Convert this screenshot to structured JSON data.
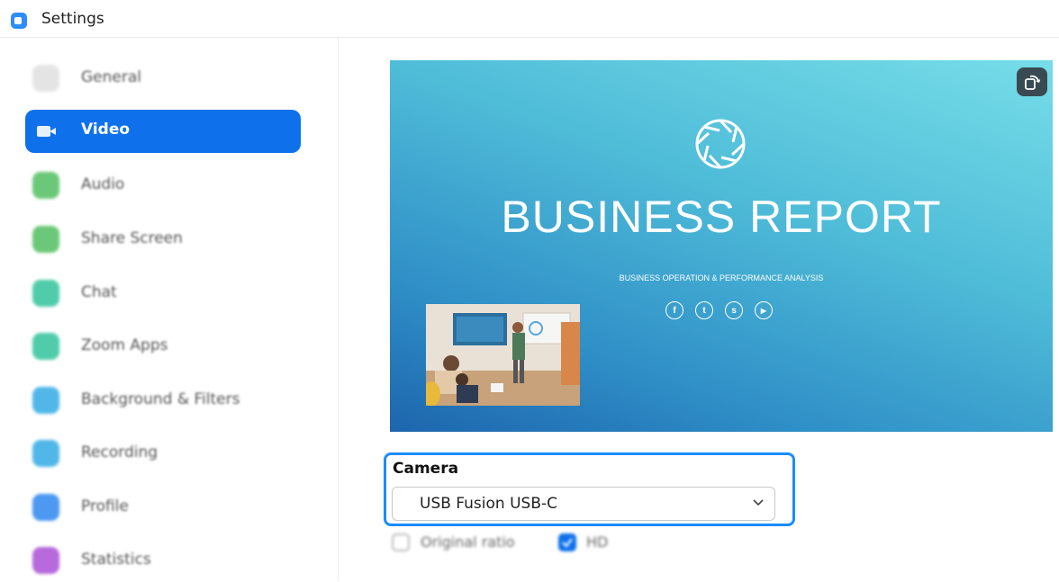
{
  "window": {
    "title": "Settings"
  },
  "sidebar": {
    "items": [
      {
        "label": "General",
        "icon": "gear-icon",
        "color": "#dcdcdc"
      },
      {
        "label": "Video",
        "icon": "video-camera-icon",
        "color": "#0e71eb",
        "active": true
      },
      {
        "label": "Audio",
        "icon": "headphones-icon",
        "color": "#5cc36a"
      },
      {
        "label": "Share Screen",
        "icon": "share-screen-icon",
        "color": "#5cc36a"
      },
      {
        "label": "Chat",
        "icon": "chat-icon",
        "color": "#3ec7a2"
      },
      {
        "label": "Zoom Apps",
        "icon": "apps-icon",
        "color": "#3ec7a2"
      },
      {
        "label": "Background & Filters",
        "icon": "background-icon",
        "color": "#3fb0e6"
      },
      {
        "label": "Recording",
        "icon": "recording-icon",
        "color": "#3fb0e6"
      },
      {
        "label": "Profile",
        "icon": "profile-icon",
        "color": "#3a8ef0"
      },
      {
        "label": "Statistics",
        "icon": "statistics-icon",
        "color": "#b05ad8"
      }
    ]
  },
  "preview": {
    "title": "BUSINESS REPORT",
    "subtitle": "BUSINESS OPERATION & PERFORMANCE ANALYSIS",
    "socials": [
      "f",
      "t",
      "s",
      "▶"
    ],
    "rotate_icon": "rotate-camera-icon"
  },
  "camera": {
    "label": "Camera",
    "selected": "USB Fusion USB-C"
  },
  "options": {
    "original_ratio": "Original ratio",
    "hd": "HD",
    "original_ratio_checked": false,
    "hd_checked": true
  },
  "colors": {
    "accent": "#0e71eb",
    "highlight": "#1a8cff"
  }
}
